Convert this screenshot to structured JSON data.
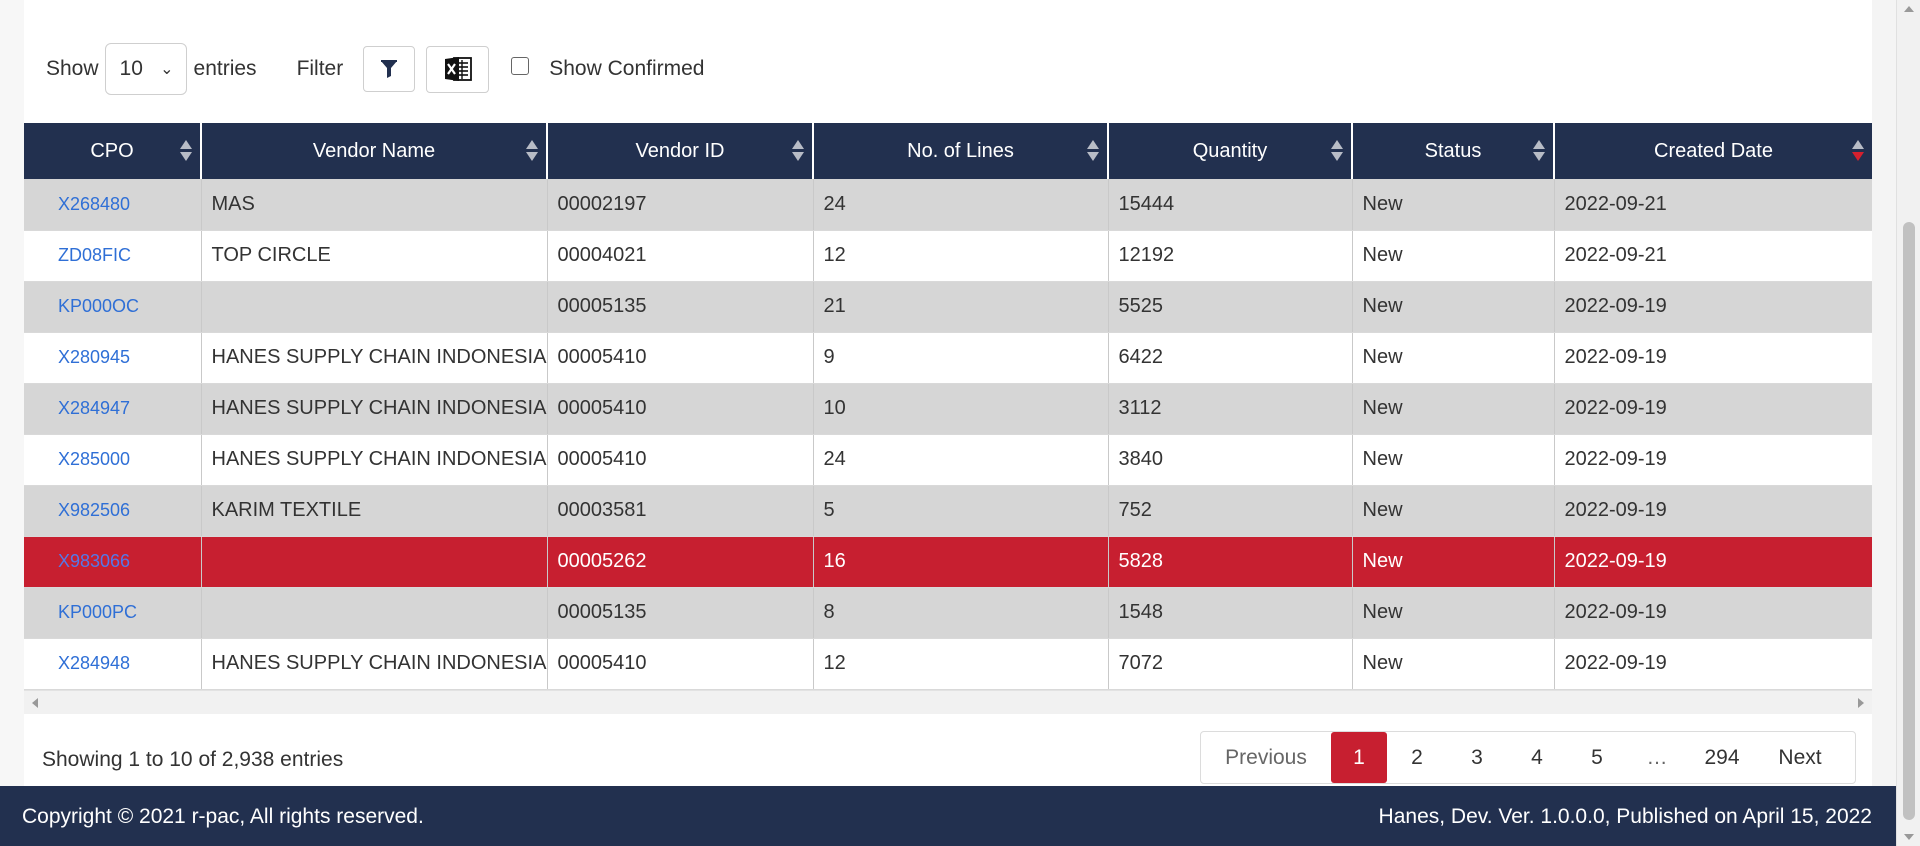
{
  "toolbar": {
    "show_label": "Show",
    "page_size": "10",
    "entries_label": "entries",
    "filter_label": "Filter",
    "show_confirmed_label": "Show Confirmed"
  },
  "table": {
    "columns": [
      "CPO",
      "Vendor Name",
      "Vendor ID",
      "No. of Lines",
      "Quantity",
      "Status",
      "Created Date"
    ],
    "sorted_column": "Created Date",
    "sort_direction": "descending",
    "rows": [
      {
        "cpo": "X268480",
        "vendor_name": "MAS",
        "vendor_id": "00002197",
        "lines": "24",
        "quantity": "15444",
        "status": "New",
        "created": "2022-09-21"
      },
      {
        "cpo": "ZD08FIC",
        "vendor_name": "TOP CIRCLE",
        "vendor_id": "00004021",
        "lines": "12",
        "quantity": "12192",
        "status": "New",
        "created": "2022-09-21"
      },
      {
        "cpo": "KP000OC",
        "vendor_name": "",
        "vendor_id": "00005135",
        "lines": "21",
        "quantity": "5525",
        "status": "New",
        "created": "2022-09-19"
      },
      {
        "cpo": "X280945",
        "vendor_name": "HANES SUPPLY CHAIN INDONESIA",
        "vendor_id": "00005410",
        "lines": "9",
        "quantity": "6422",
        "status": "New",
        "created": "2022-09-19"
      },
      {
        "cpo": "X284947",
        "vendor_name": "HANES SUPPLY CHAIN INDONESIA",
        "vendor_id": "00005410",
        "lines": "10",
        "quantity": "3112",
        "status": "New",
        "created": "2022-09-19"
      },
      {
        "cpo": "X285000",
        "vendor_name": "HANES SUPPLY CHAIN INDONESIA",
        "vendor_id": "00005410",
        "lines": "24",
        "quantity": "3840",
        "status": "New",
        "created": "2022-09-19"
      },
      {
        "cpo": "X982506",
        "vendor_name": "KARIM TEXTILE",
        "vendor_id": "00003581",
        "lines": "5",
        "quantity": "752",
        "status": "New",
        "created": "2022-09-19"
      },
      {
        "cpo": "X983066",
        "vendor_name": "",
        "vendor_id": "00005262",
        "lines": "16",
        "quantity": "5828",
        "status": "New",
        "created": "2022-09-19"
      },
      {
        "cpo": "KP000PC",
        "vendor_name": "",
        "vendor_id": "00005135",
        "lines": "8",
        "quantity": "1548",
        "status": "New",
        "created": "2022-09-19"
      },
      {
        "cpo": "X284948",
        "vendor_name": "HANES SUPPLY CHAIN INDONESIA",
        "vendor_id": "00005410",
        "lines": "12",
        "quantity": "7072",
        "status": "New",
        "created": "2022-09-19"
      }
    ]
  },
  "pagination": {
    "info": "Showing 1 to 10 of 2,938 entries",
    "previous": "Previous",
    "pages": [
      "1",
      "2",
      "3",
      "4",
      "5"
    ],
    "ellipsis": "…",
    "last_page": "294",
    "next": "Next",
    "current": "1"
  },
  "footer": {
    "copyright": "Copyright © 2021 r-pac, All rights reserved.",
    "version": "Hanes, Dev. Ver. 1.0.0.0, Published on April 15, 2022"
  },
  "colors": {
    "header_bg": "#22304f",
    "highlight_row": "#c71f30",
    "link": "#2f6fd6",
    "active_page": "#c71f30"
  }
}
